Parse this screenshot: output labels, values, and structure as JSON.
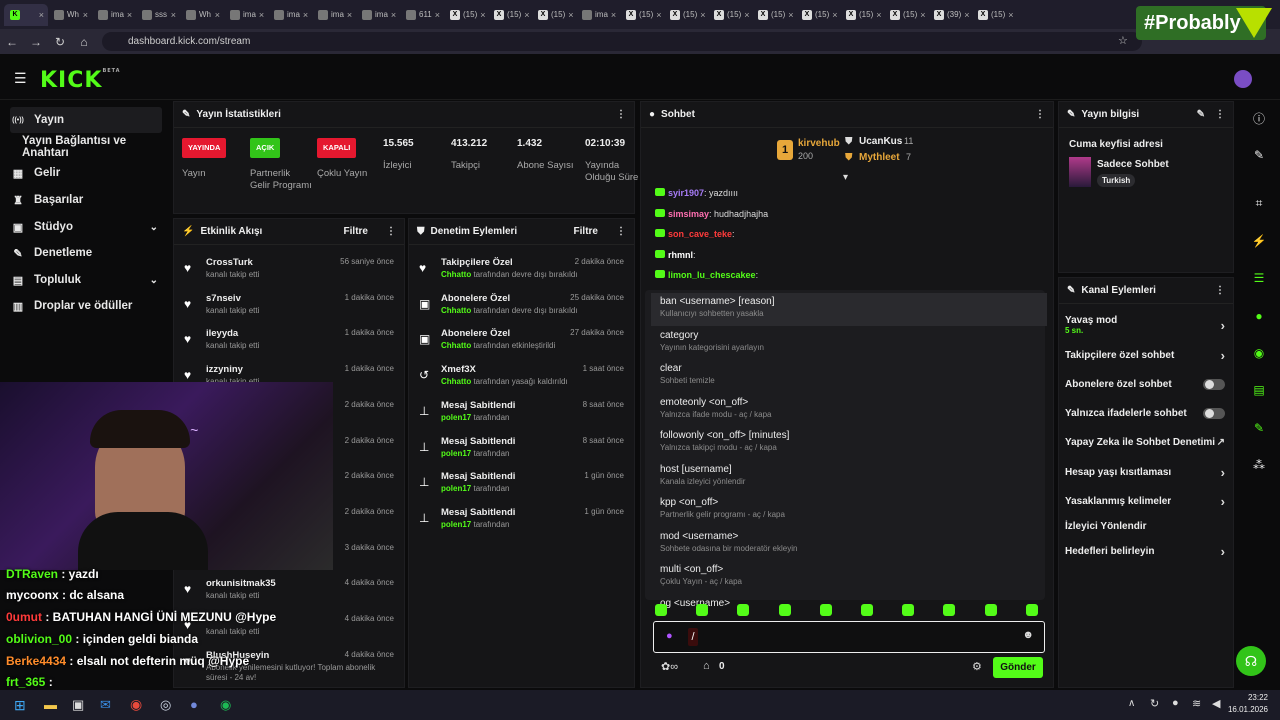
{
  "browser": {
    "tabs": [
      "",
      "Wh",
      "ima",
      "sss",
      "Wh",
      "ima",
      "ima",
      "ima",
      "ima",
      "611",
      "(15)",
      "(15)",
      "(15)",
      "ima",
      "(15)",
      "(15)",
      "(15)",
      "(15)",
      "(15)",
      "(15)",
      "(15)",
      "(39)",
      "(15)"
    ],
    "url": "dashboard.kick.com/stream"
  },
  "watermark": "#Probably",
  "leftnav": {
    "items": [
      {
        "label": "Yayın",
        "icon": "broadcast-icon"
      },
      {
        "label": "Yayın Bağlantısı ve Anahtarı",
        "icon": ""
      },
      {
        "label": "Gelir",
        "icon": "revenue-icon"
      },
      {
        "label": "Başarılar",
        "icon": "trophy-icon"
      },
      {
        "label": "Stüdyo",
        "icon": "studio-icon"
      },
      {
        "label": "Denetleme",
        "icon": "wrench-icon"
      },
      {
        "label": "Topluluk",
        "icon": "community-icon"
      },
      {
        "label": "Droplar ve ödüller",
        "icon": "drops-icon"
      }
    ]
  },
  "stats": {
    "title": "Yayın İstatistikleri",
    "items": [
      {
        "badge": "YAYINDA",
        "badge_color": "#e5182f",
        "label": "Yayın"
      },
      {
        "badge": "AÇIK",
        "badge_color": "#32c419",
        "label": "Partnerlik Gelir Programı"
      },
      {
        "badge": "KAPALI",
        "badge_color": "#e5182f",
        "label": "Çoklu Yayın"
      },
      {
        "value": "15.565",
        "label": "İzleyici"
      },
      {
        "value": "413.212",
        "label": "Takipçi"
      },
      {
        "value": "1.432",
        "label": "Abone Sayısı"
      },
      {
        "value": "02:10:39",
        "label": "Yayında Olduğu Süre"
      }
    ]
  },
  "activity": {
    "title": "Etkinlik Akışı",
    "filter": "Filtre",
    "rows": [
      {
        "name": "CrossTurk",
        "sub": "kanalı takip etti",
        "time": "56 saniye önce"
      },
      {
        "name": "s7nseiv",
        "sub": "kanalı takip etti",
        "time": "1 dakika önce"
      },
      {
        "name": "ileyyda",
        "sub": "kanalı takip etti",
        "time": "1 dakika önce"
      },
      {
        "name": "izzyniny",
        "sub": "kanalı takip etti",
        "time": "1 dakika önce"
      },
      {
        "name": "",
        "sub": "",
        "time": "2 dakika önce"
      },
      {
        "name": "",
        "sub": "",
        "time": "2 dakika önce"
      },
      {
        "name": "",
        "sub": "",
        "time": "2 dakika önce"
      },
      {
        "name": "",
        "sub": "",
        "time": "2 dakika önce"
      },
      {
        "name": "",
        "sub": "",
        "time": "3 dakika önce"
      },
      {
        "name": "orkunisitmak35",
        "sub": "kanalı takip etti",
        "time": "4 dakika önce"
      },
      {
        "name": "",
        "sub": "kanalı takip etti",
        "time": "4 dakika önce"
      },
      {
        "name": "BlushHuseyin",
        "sub": "Abonelik yenilemesini kutluyor! Toplam abonelik süresi - 24 av!",
        "time": "4 dakika önce"
      }
    ]
  },
  "moderation": {
    "title": "Denetim Eylemleri",
    "filter": "Filtre",
    "rows": [
      {
        "icon": "heart-icon",
        "name": "Takipçilere Özel",
        "who": "Chhatto",
        "sub": "tarafından devre dışı bırakıldı",
        "time": "2 dakika önce"
      },
      {
        "icon": "gift-icon",
        "name": "Abonelere Özel",
        "who": "Chhatto",
        "sub": "tarafından devre dışı bırakıldı",
        "time": "25 dakika önce"
      },
      {
        "icon": "gift-icon",
        "name": "Abonelere Özel",
        "who": "Chhatto",
        "sub": "tarafından etkinleştirildi",
        "time": "27 dakika önce"
      },
      {
        "icon": "unban-icon",
        "name": "Xmef3X",
        "who": "Chhatto",
        "sub": "tarafından yasağı kaldırıldı",
        "time": "1 saat önce"
      },
      {
        "icon": "pin-icon",
        "name": "Mesaj Sabitlendi",
        "who": "polen17",
        "sub": "tarafından",
        "time": "8 saat önce"
      },
      {
        "icon": "pin-icon",
        "name": "Mesaj Sabitlendi",
        "who": "polen17",
        "sub": "tarafından",
        "time": "8 saat önce"
      },
      {
        "icon": "pin-icon",
        "name": "Mesaj Sabitlendi",
        "who": "polen17",
        "sub": "tarafından",
        "time": "1 gün önce"
      },
      {
        "icon": "pin-icon",
        "name": "Mesaj Sabitlendi",
        "who": "polen17",
        "sub": "tarafından",
        "time": "1 gün önce"
      }
    ]
  },
  "chat": {
    "title": "Sohbet",
    "leaders": [
      {
        "rank": "1",
        "name": "kirvehub",
        "count": "200"
      },
      {
        "name": "UcanKus",
        "count": "11"
      },
      {
        "name": "Mythleet",
        "count": "7"
      }
    ],
    "messages": [
      {
        "user": "syir1907",
        "color": "#a77cf7",
        "text": ": yazdıııı"
      },
      {
        "user": "simsimay",
        "color": "#ff6fb0",
        "text": ": hudhadjhajha"
      },
      {
        "user": "son_cave_teke",
        "color": "#ff3b3b",
        "text": ":"
      },
      {
        "user": "rhmnl",
        "color": "#ffffff",
        "text": ":"
      },
      {
        "user": "limon_lu_chescakee",
        "color": "#53fc18",
        "text": ":"
      }
    ],
    "commands": [
      {
        "cmd": "ban <username> [reason]",
        "desc": "Kullanıcıyı sohbetten yasakla"
      },
      {
        "cmd": "category",
        "desc": "Yayının kategorisini ayarlayın"
      },
      {
        "cmd": "clear",
        "desc": "Sohbeti temizle"
      },
      {
        "cmd": "emoteonly <on_off>",
        "desc": "Yalnızca ifade modu - aç / kapa"
      },
      {
        "cmd": "followonly <on_off> [minutes]",
        "desc": "Yalnızca takipçi modu - aç / kapa"
      },
      {
        "cmd": "host [username]",
        "desc": "Kanala izleyici yönlendir"
      },
      {
        "cmd": "kpp <on_off>",
        "desc": "Partnerlik gelir programı - aç / kapa"
      },
      {
        "cmd": "mod <username>",
        "desc": "Sohbete odasına bir moderatör ekleyin"
      },
      {
        "cmd": "multi <on_off>",
        "desc": "Çoklu Yayın - aç / kapa"
      },
      {
        "cmd": "og <username>",
        "desc": ""
      }
    ],
    "input_value": "/",
    "points": "0",
    "send_label": "Gönder"
  },
  "streaminfo": {
    "title": "Yayın bilgisi",
    "stream_title": "Cuma keyfisi adresi",
    "category": "Sadece Sohbet",
    "tag": "Turkish"
  },
  "channel_actions": {
    "title": "Kanal Eylemleri",
    "items": [
      {
        "label": "Yavaş mod",
        "sub": "5 sn.",
        "control": "arrow"
      },
      {
        "label": "Takipçilere özel sohbet",
        "control": "arrow"
      },
      {
        "label": "Abonelere özel sohbet",
        "control": "toggle"
      },
      {
        "label": "Yalnızca ifadelerle sohbet",
        "control": "toggle"
      },
      {
        "label": "Yapay Zeka ile Sohbet Denetimi",
        "control": "external"
      },
      {
        "label": "Hesap yaşı kısıtlaması",
        "control": "arrow"
      },
      {
        "label": "Yasaklanmış kelimeler",
        "control": "arrow"
      },
      {
        "label": "İzleyici Yönlendir",
        "control": "none"
      },
      {
        "label": "Hedefleri belirleyin",
        "control": "arrow"
      }
    ]
  },
  "overlay_chat": [
    {
      "user": "DTRaven",
      "color": "#53fc18",
      "text": " : yazdı"
    },
    {
      "user": "mycoonx",
      "color": "#ffffff",
      "text": " : dc alsana"
    },
    {
      "user": "0umut",
      "color": "#ff3b3b",
      "text": " : BATUHAN HANGİ ÜNİ MEZUNU @Hype"
    },
    {
      "user": "oblivion_00",
      "color": "#53fc18",
      "text": " : içinden geldi bianda"
    },
    {
      "user": "Berke4434",
      "color": "#ff8c2b",
      "text": " : elsalı not defterin müq @Hype"
    },
    {
      "user": "frt_365",
      "color": "#53fc18",
      "text": " :"
    }
  ],
  "taskbar": {
    "time": "23:22",
    "date": "16.01.2026"
  }
}
